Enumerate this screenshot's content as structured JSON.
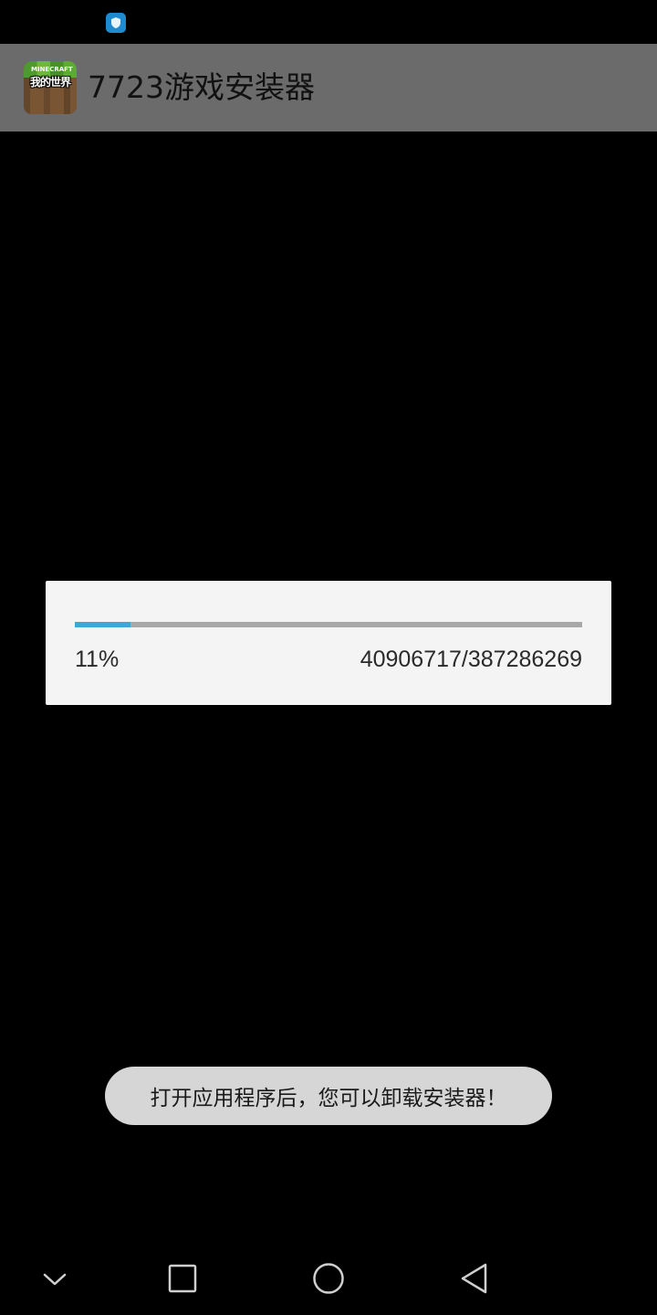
{
  "status_bar": {
    "notification_icon": "shield-icon",
    "accent": "#1e8bd1"
  },
  "app_bar": {
    "title": "7723游戏安装器",
    "app_icon": "minecraft-app-icon",
    "app_icon_text": "我的世界",
    "app_icon_small_text": "MINECRAFT",
    "background": "#6b6b6b"
  },
  "dialog": {
    "progress_percent_label": "11%",
    "progress_fraction": 0.11,
    "progress_count": "40906717/387286269",
    "progress_color": "#3ea7d9"
  },
  "toast": {
    "message": "打开应用程序后，您可以卸载安装器！"
  },
  "nav_bar": {
    "buttons": [
      {
        "name": "collapse",
        "icon": "chevron-down-icon"
      },
      {
        "name": "recents",
        "icon": "square-icon"
      },
      {
        "name": "home",
        "icon": "circle-icon"
      },
      {
        "name": "back",
        "icon": "triangle-back-icon"
      }
    ]
  }
}
